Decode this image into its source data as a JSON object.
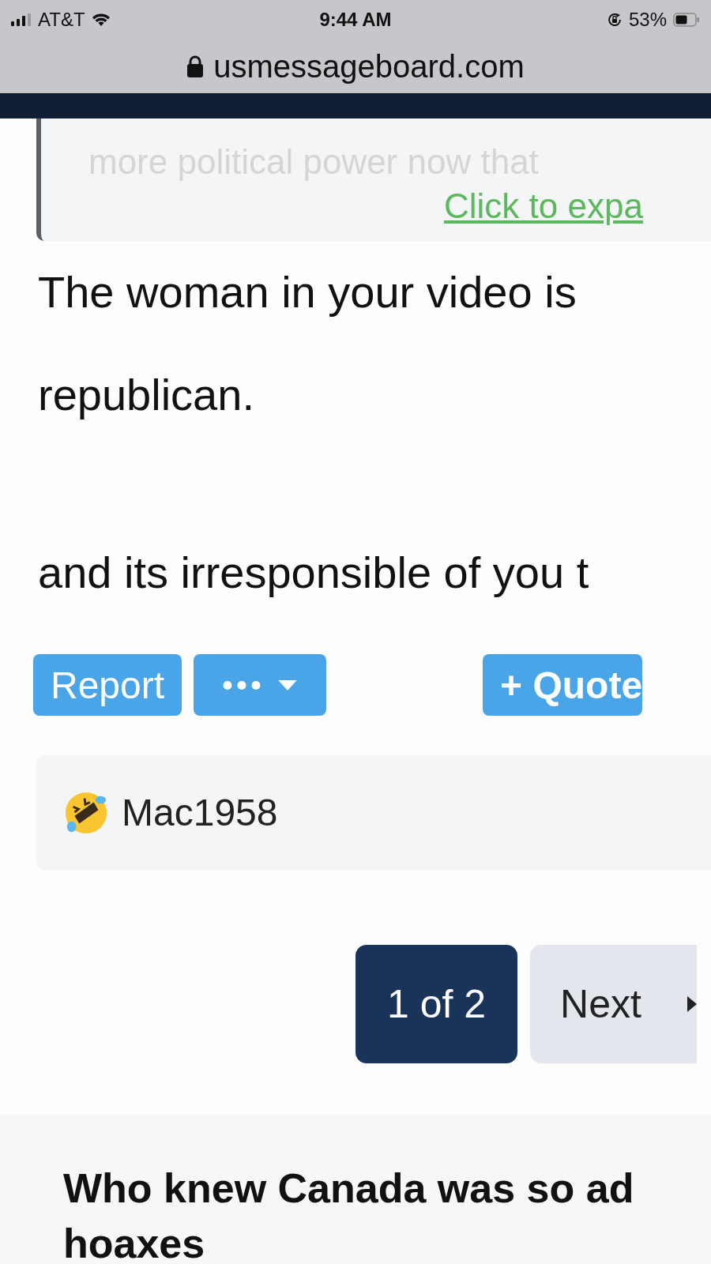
{
  "status_bar": {
    "carrier": "AT&T",
    "time": "9:44 AM",
    "battery": "53%"
  },
  "address_bar": {
    "url": "usmessageboard.com"
  },
  "quote": {
    "text": "more political power now that",
    "expand_link": "Click to expa"
  },
  "post": {
    "paragraphs": [
      {
        "lines": [
          "The woman in your video is",
          "republican."
        ]
      },
      {
        "lines": [
          "and its irresponsible of you t"
        ]
      }
    ]
  },
  "actions": {
    "report": "Report",
    "more": "•••",
    "quote": "+ Quote"
  },
  "reactions": {
    "users": "Mac1958"
  },
  "pagination": {
    "current": "1 of 2",
    "next": "Next"
  },
  "next_thread": {
    "title_lines": [
      "Who knew Canada was so ad",
      "hoaxes"
    ]
  }
}
